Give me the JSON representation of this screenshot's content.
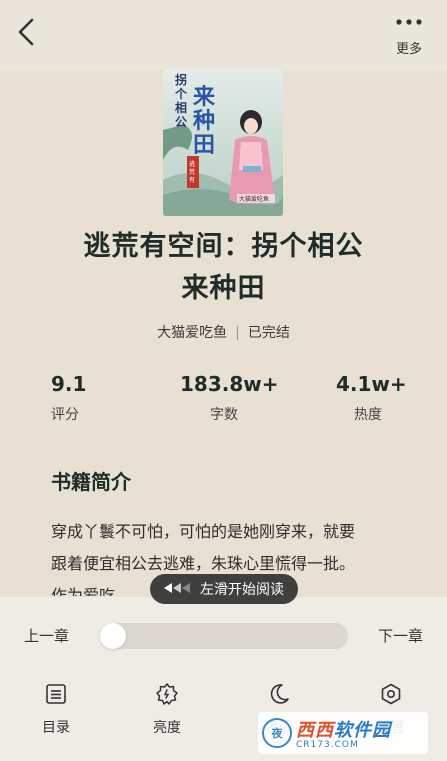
{
  "header": {
    "back_icon": "chevron-left-icon",
    "more_icon": "more-dots-icon",
    "more_label": "更多"
  },
  "book": {
    "cover_title": "拐个相公来种田",
    "cover_subtitle": "逃荒有空间",
    "cover_author": "大猫爱吃鱼",
    "title_line1": "逃荒有空间：拐个相公",
    "title_line2": "来种田",
    "author": "大猫爱吃鱼",
    "status": "已完结"
  },
  "stats": {
    "rating_value": "9.1",
    "rating_label": "评分",
    "words_value": "183.8w+",
    "words_label": "字数",
    "heat_value": "4.1w+",
    "heat_label": "热度"
  },
  "intro": {
    "title": "书籍简介",
    "line1": "穿成丫鬟不可怕，可怕的是她刚穿来，就要",
    "line2": "跟着便宜相公去逃难，朱珠心里慌得一批。",
    "line3": "作为爱吃..."
  },
  "swipe_hint": {
    "icon": "swipe-left-arrows-icon",
    "label": "左滑开始阅读"
  },
  "chapter_nav": {
    "prev_label": "上一章",
    "next_label": "下一章",
    "progress": 0
  },
  "tabs": [
    {
      "label": "目录",
      "icon": "list-icon"
    },
    {
      "label": "亮度",
      "icon": "brightness-icon"
    },
    {
      "label": "夜间",
      "icon": "moon-icon"
    },
    {
      "label": "设置",
      "icon": "settings-icon"
    }
  ],
  "watermark": {
    "circle": "夜",
    "main_a": "西西",
    "main_b": "软件园",
    "sub": "CR173.COM"
  },
  "colors": {
    "background": "#e8e0d2",
    "panel": "#efece6",
    "title": "#1f2d2a"
  }
}
